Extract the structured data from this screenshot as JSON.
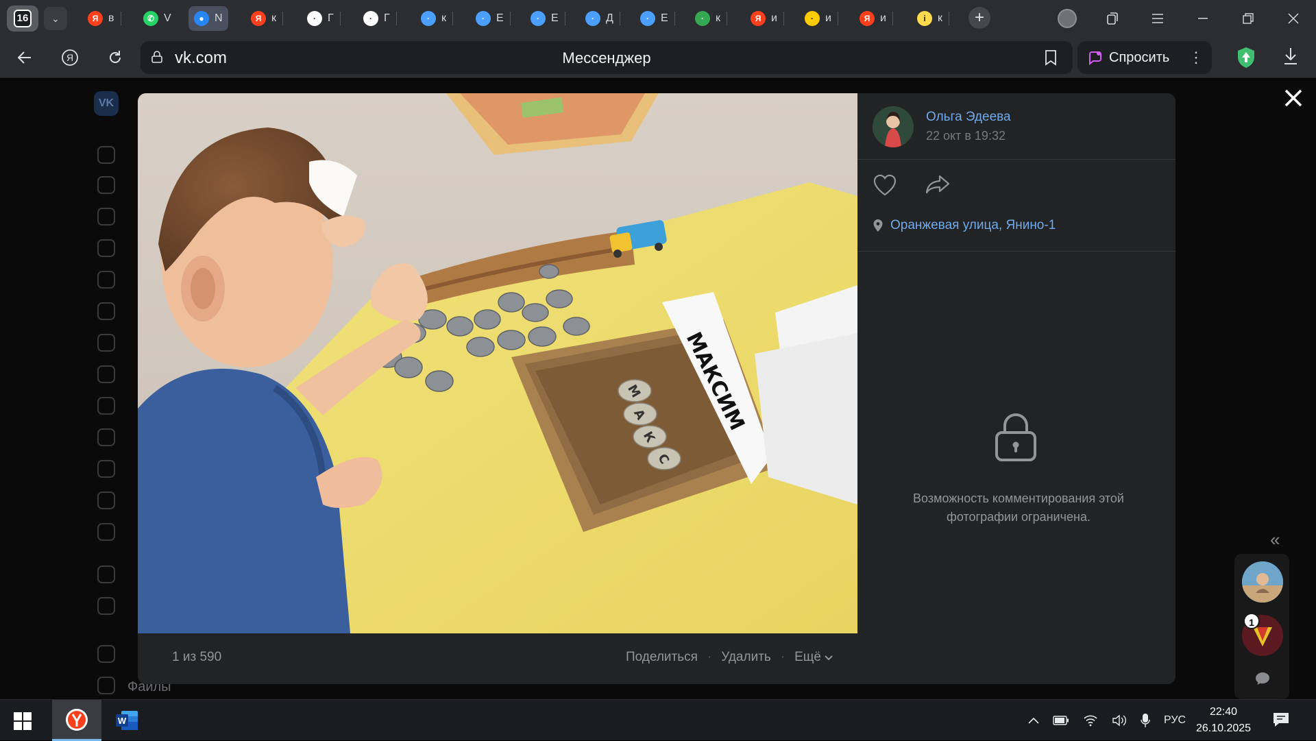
{
  "browser": {
    "tab_count": "16",
    "tabs": [
      {
        "label": "в",
        "icon": "yandex-icon",
        "color": "#fc3f1d"
      },
      {
        "label": "V",
        "icon": "whatsapp-icon",
        "color": "#25d366"
      },
      {
        "label": "N",
        "icon": "vk-messenger-icon",
        "color": "#2787f5"
      },
      {
        "label": "к",
        "icon": "yandex-icon",
        "color": "#fc3f1d"
      },
      {
        "label": "Г",
        "icon": "emblem-icon",
        "color": "#ffffff"
      },
      {
        "label": "Г",
        "icon": "emblem-icon",
        "color": "#ffffff"
      },
      {
        "label": "к",
        "icon": "site-icon",
        "color": "#4a9fff"
      },
      {
        "label": "Е",
        "icon": "site-icon",
        "color": "#4a9fff"
      },
      {
        "label": "Е",
        "icon": "site-icon",
        "color": "#4a9fff"
      },
      {
        "label": "Д",
        "icon": "site-icon",
        "color": "#4a9fff"
      },
      {
        "label": "Е",
        "icon": "site-icon",
        "color": "#4a9fff"
      },
      {
        "label": "к",
        "icon": "drive-icon",
        "color": "#34a853"
      },
      {
        "label": "и",
        "icon": "yandex-icon",
        "color": "#fc3f1d"
      },
      {
        "label": "и",
        "icon": "images-icon",
        "color": "#ffcc00"
      },
      {
        "label": "и",
        "icon": "yandex-icon",
        "color": "#fc3f1d"
      },
      {
        "label": "к",
        "icon": "info-icon",
        "color": "#ffdb4d"
      }
    ],
    "url": "vk.com",
    "page_title": "Мессенджер",
    "ask_label": "Спросить"
  },
  "viewer": {
    "author_name": "Ольга Эдеева",
    "date": "22 окт в 19:32",
    "location": "Оранжевая улица, Янино-1",
    "comments_closed": "Возможность комментирования этой фотографии ограничена.",
    "counter": "1 из 590",
    "actions": {
      "share": "Поделиться",
      "delete": "Удалить",
      "more": "Ещё"
    },
    "photo_card_text": "МАКСИМ",
    "tray_letters": [
      "М",
      "А",
      "К",
      "С"
    ]
  },
  "sidebar_bg": {
    "last_item": "Файлы"
  },
  "dock": {
    "badge": "1"
  },
  "taskbar": {
    "language": "РУС",
    "time": "22:40",
    "date": "26.10.2025"
  }
}
